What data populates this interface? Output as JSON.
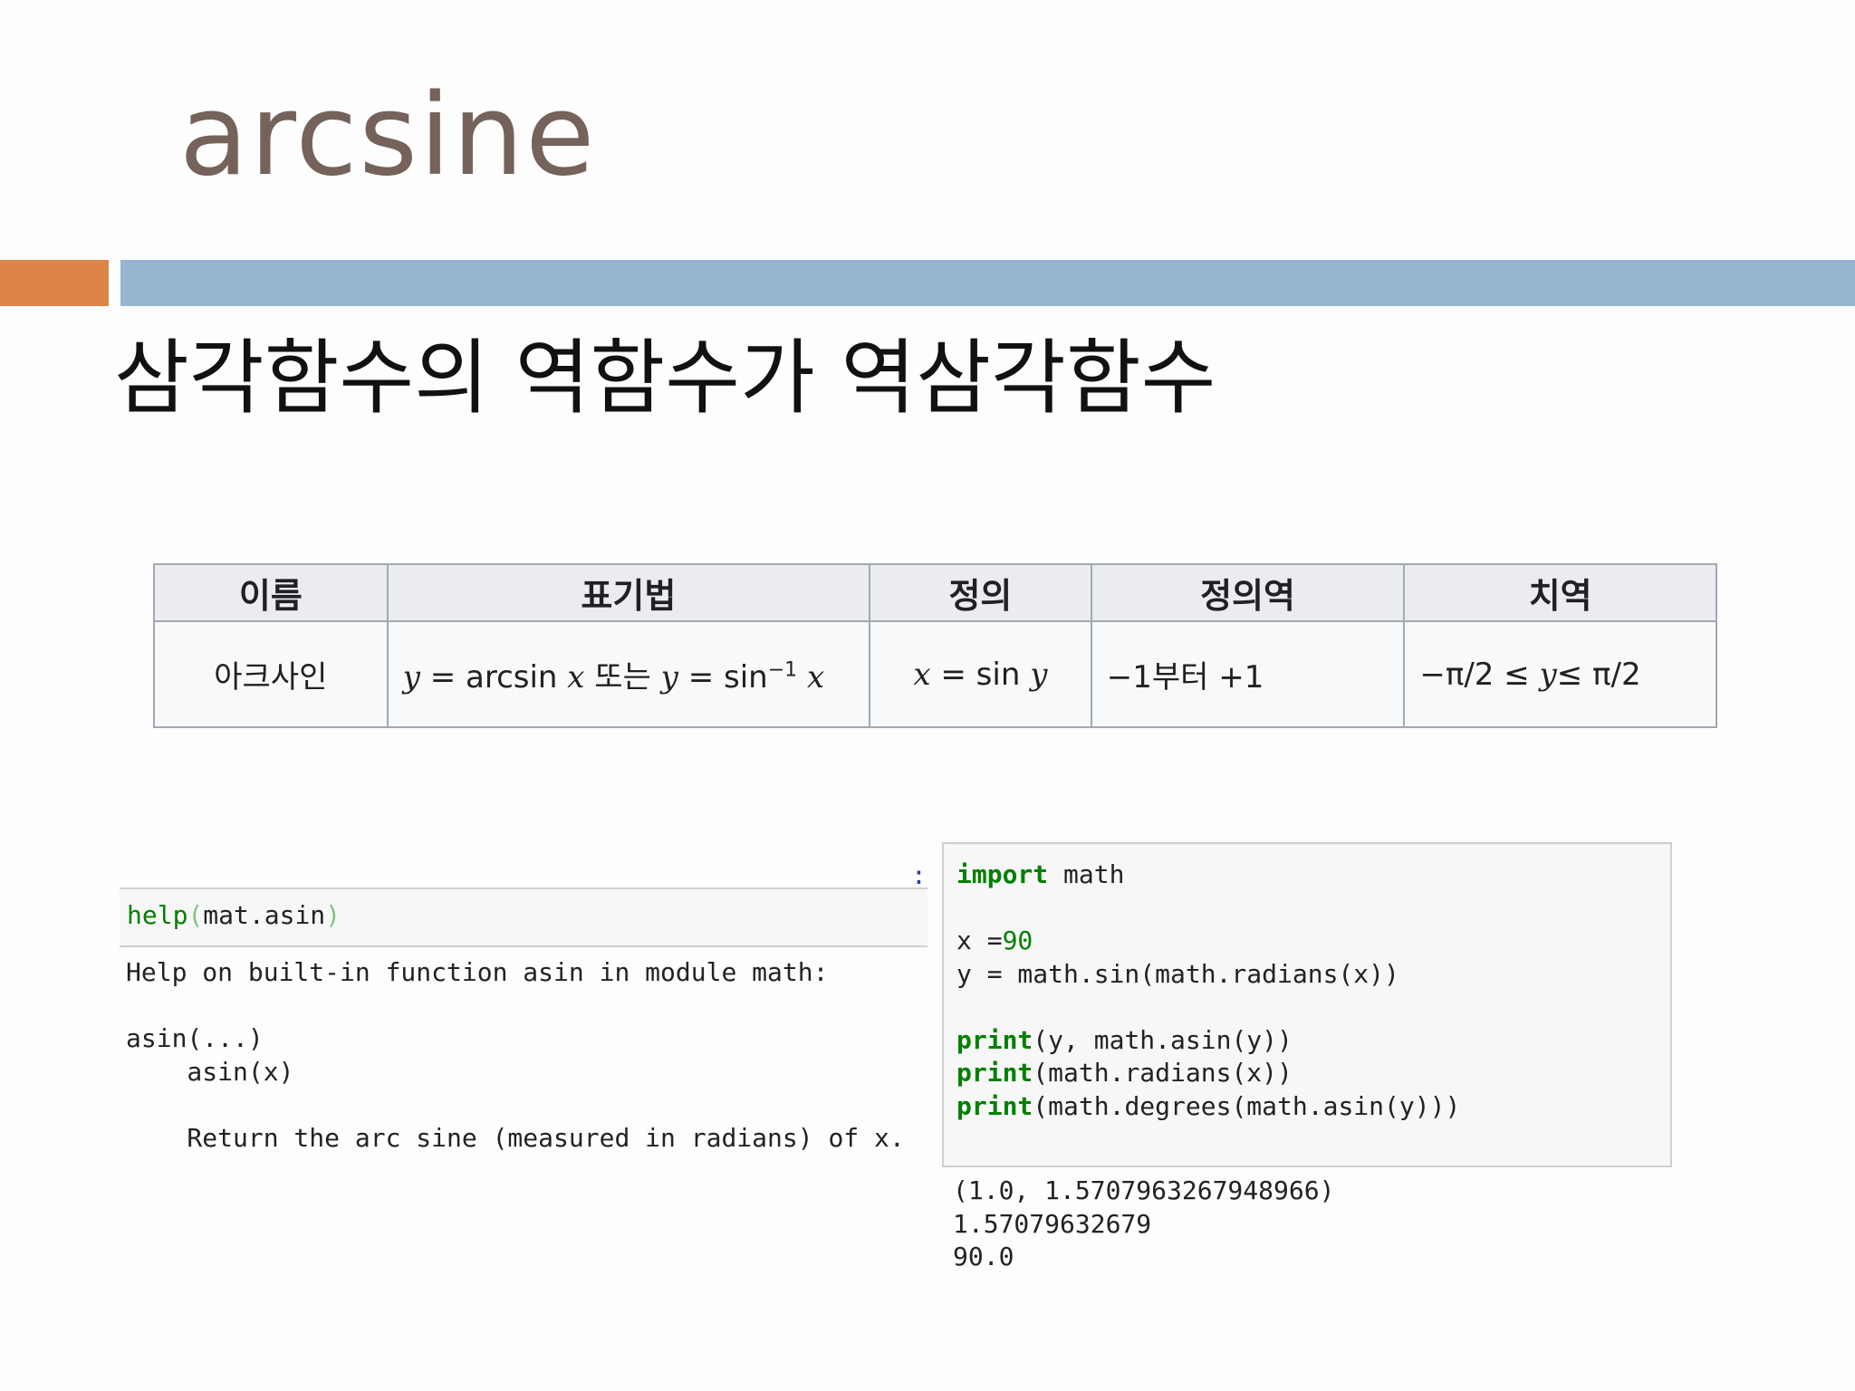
{
  "slide": {
    "title": "arcsine",
    "subtitle": "삼각함수의 역함수가 역삼각함수"
  },
  "table": {
    "headers": [
      "이름",
      "표기법",
      "정의",
      "정의역",
      "치역"
    ],
    "row": {
      "name": "아크사인",
      "notation": {
        "y1": "y",
        "eq1": " = arcsin ",
        "x1": "x",
        "or": " 또는 ",
        "y2": "y",
        "eq2": " = sin",
        "sup": "−1",
        "x2": "x"
      },
      "definition": {
        "x": "x",
        "eq": " = sin ",
        "y": "y"
      },
      "domain": "−1부터 +1",
      "range": {
        "left": "−π/2 ≤ ",
        "y": "y",
        "right": "≤ π/2"
      }
    }
  },
  "help_cell": {
    "prompt": ":",
    "func": "help",
    "open": "(",
    "arg": "mat.asin",
    "close": ")",
    "output": "Help on built-in function asin in module math:\n\nasin(...)\n    asin(x)\n\n    Return the arc sine (measured in radians) of x."
  },
  "code_cell": {
    "lines": {
      "l1_kw": "import",
      "l1_rest": " math",
      "l3_pre": "x =",
      "l3_num": "90",
      "l4": "y = math.sin(math.radians(x))",
      "print_kw": "print",
      "l6_rest": "(y, math.asin(y))",
      "l7_rest": "(math.radians(x))",
      "l8_rest": "(math.degrees(math.asin(y)))"
    },
    "output": "(1.0, 1.5707963267948966)\n1.57079632679\n90.0"
  },
  "colors": {
    "title": "#75625b",
    "accent_orange": "#dc844a",
    "accent_blue": "#95b5d1",
    "keyword": "#008000"
  }
}
